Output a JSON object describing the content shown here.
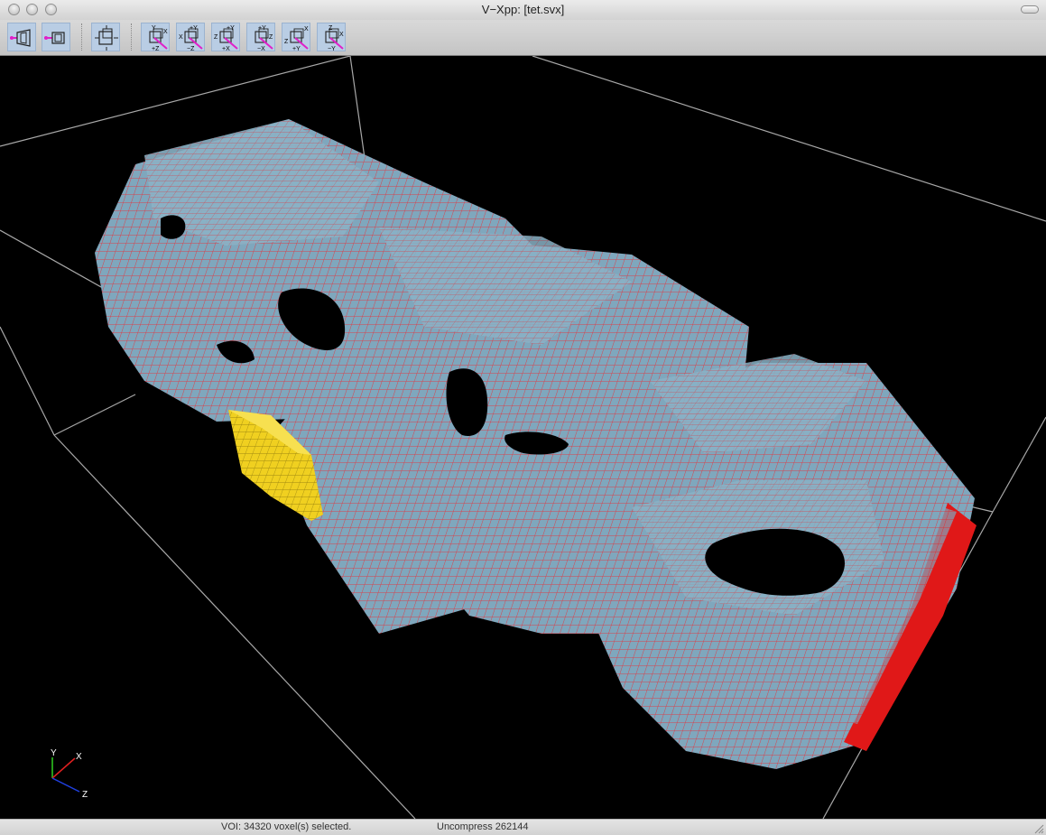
{
  "window": {
    "title": "V−Xpp: [tet.svx]"
  },
  "toolbar": {
    "buttons": [
      {
        "name": "zoom-in-button",
        "icon": "zoom-in-icon"
      },
      {
        "name": "zoom-out-button",
        "icon": "zoom-out-icon"
      },
      {
        "name": "fit-view-button",
        "icon": "fit-view-icon"
      },
      {
        "name": "view-plus-z-button",
        "icon": "view-plus-z-icon",
        "labels": [
          "Y",
          "X",
          "+Z"
        ]
      },
      {
        "name": "view-minus-z-button",
        "icon": "view-minus-z-icon",
        "labels": [
          "+Y",
          "X",
          "−Z"
        ]
      },
      {
        "name": "view-plus-x-button",
        "icon": "view-plus-x-icon",
        "labels": [
          "+Y",
          "Z",
          "+X"
        ]
      },
      {
        "name": "view-minus-x-button",
        "icon": "view-minus-x-icon",
        "labels": [
          "+Y",
          "Z",
          "−X"
        ]
      },
      {
        "name": "view-plus-y-button",
        "icon": "view-plus-y-icon",
        "labels": [
          "X",
          "Z",
          "+Y"
        ]
      },
      {
        "name": "view-minus-y-button",
        "icon": "view-minus-y-icon",
        "labels": [
          "Z",
          "X",
          "−Y"
        ]
      }
    ]
  },
  "viewport": {
    "background": "#000000",
    "voxel_color": "#7fa7bd",
    "voxel_edge_color": "#d9404a",
    "selected_color": "#f0d020",
    "bounding_box_color": "#a8a8a8",
    "axes": {
      "y_label": "Y",
      "x_label": "X",
      "z_label": "Z"
    }
  },
  "status": {
    "voi": "VOI: 34320 voxel(s) selected.",
    "uncompress": "Uncompress 262144"
  }
}
